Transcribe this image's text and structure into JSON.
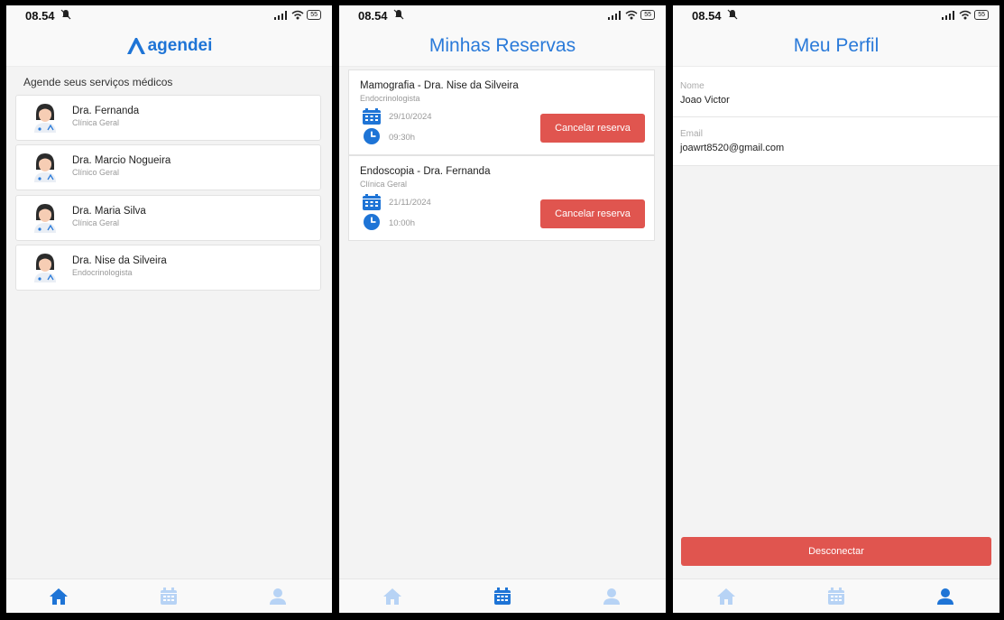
{
  "status_bar": {
    "time": "08.54",
    "battery": "55"
  },
  "colors": {
    "accent": "#1e74d6",
    "danger": "#e0554f",
    "tab_inactive": "#b7d3f5"
  },
  "home": {
    "logo_text": "agendei",
    "subtitle": "Agende seus serviços médicos",
    "doctors": [
      {
        "name": "Dra. Fernanda",
        "specialty": "Clínica Geral"
      },
      {
        "name": "Dra. Marcio Nogueira",
        "specialty": "Clínico Geral"
      },
      {
        "name": "Dra. Maria Silva",
        "specialty": "Clínica Geral"
      },
      {
        "name": "Dra. Nise da Silveira",
        "specialty": "Endocrinologista"
      }
    ]
  },
  "reservations": {
    "title": "Minhas Reservas",
    "cancel_label": "Cancelar reserva",
    "items": [
      {
        "title": "Mamografia - Dra. Nise da Silveira",
        "specialty": "Endocrinologista",
        "date": "29/10/2024",
        "time": "09:30h"
      },
      {
        "title": "Endoscopia - Dra. Fernanda",
        "specialty": "Clínica Geral",
        "date": "21/11/2024",
        "time": "10:00h"
      }
    ]
  },
  "profile": {
    "title": "Meu Perfil",
    "name_label": "Nome",
    "name_value": "Joao Victor",
    "email_label": "Email",
    "email_value": "joawrt8520@gmail.com",
    "logout_label": "Desconectar"
  },
  "tabs": [
    "home-icon",
    "calendar-icon",
    "user-icon"
  ]
}
